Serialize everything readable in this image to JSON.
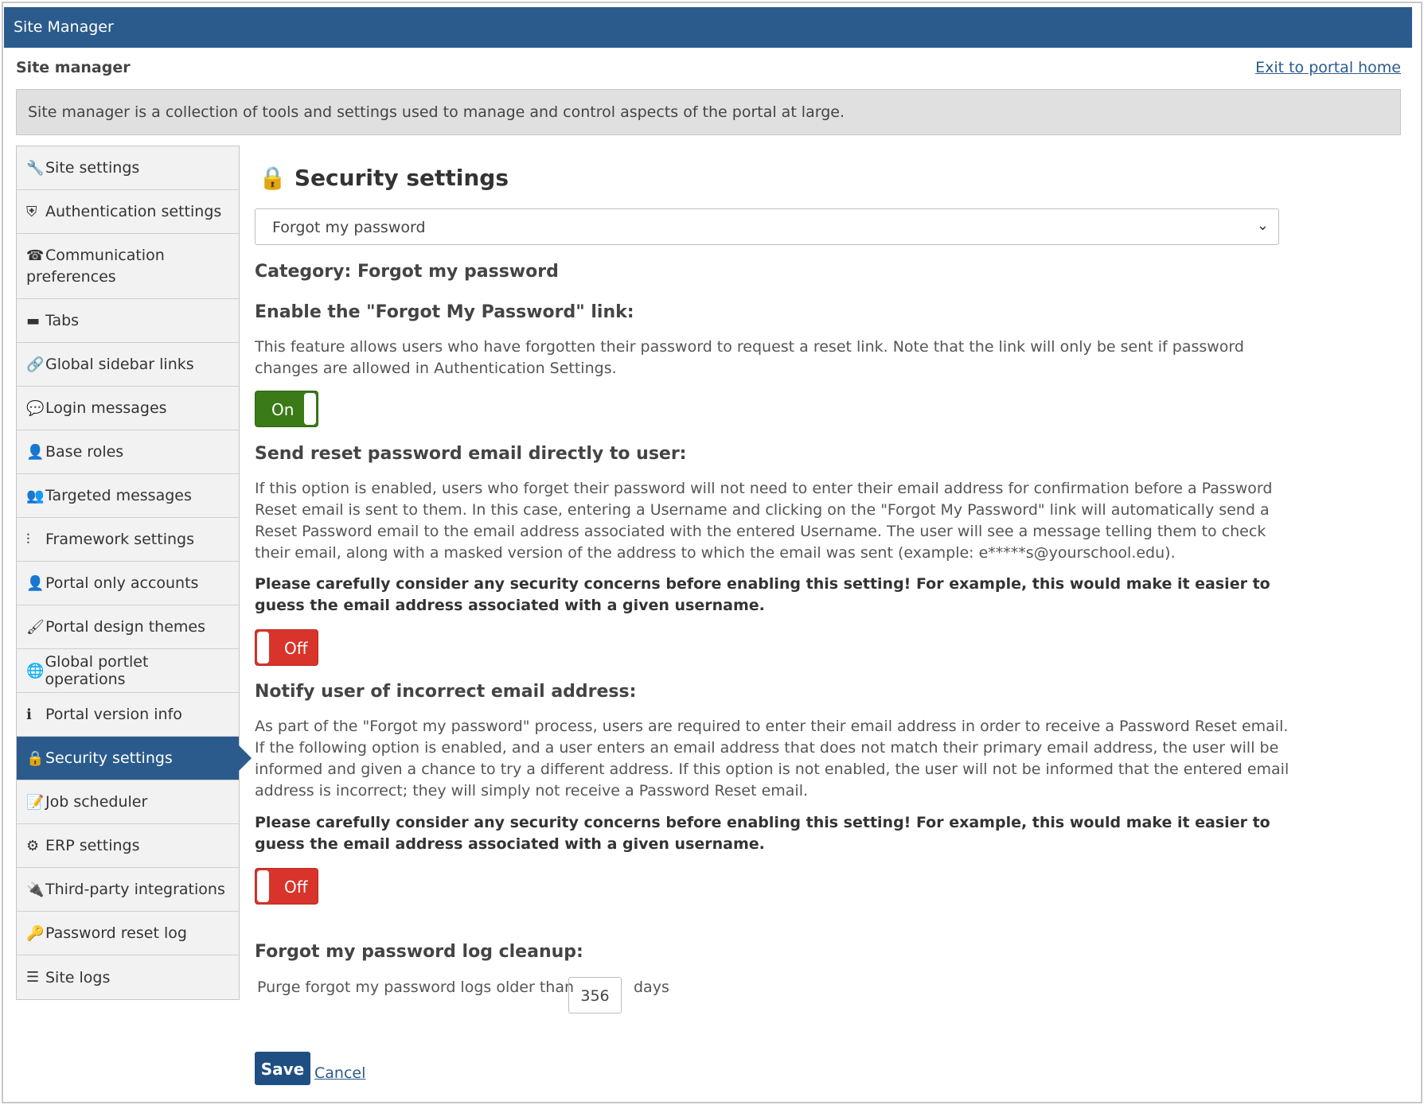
{
  "titlebar": {
    "title": "Site Manager"
  },
  "header": {
    "page_title": "Site manager",
    "exit_link": "Exit to portal home"
  },
  "info": {
    "text": "Site manager is a collection of tools and settings used to manage and control aspects of the portal at large."
  },
  "sidebar": {
    "items": [
      {
        "label": "Site settings",
        "icon": "wrench-icon",
        "glyph": "🔧"
      },
      {
        "label": "Authentication settings",
        "icon": "shield-icon",
        "glyph": "⛨"
      },
      {
        "label": "Communication preferences",
        "icon": "phone-icon",
        "glyph": "☎"
      },
      {
        "label": "Tabs",
        "icon": "folder-icon",
        "glyph": "▬"
      },
      {
        "label": "Global sidebar links",
        "icon": "link-icon",
        "glyph": "🔗"
      },
      {
        "label": "Login messages",
        "icon": "speech-bubble-icon",
        "glyph": "💬"
      },
      {
        "label": "Base roles",
        "icon": "user-role-icon",
        "glyph": "👤"
      },
      {
        "label": "Targeted messages",
        "icon": "users-group-icon",
        "glyph": "👥"
      },
      {
        "label": "Framework settings",
        "icon": "sliders-icon",
        "glyph": "⫶"
      },
      {
        "label": "Portal only accounts",
        "icon": "user-icon",
        "glyph": "👤"
      },
      {
        "label": "Portal design themes",
        "icon": "brush-icon",
        "glyph": "🖌"
      },
      {
        "label": "Global portlet operations",
        "icon": "globe-icon",
        "glyph": "🌐"
      },
      {
        "label": "Portal version info",
        "icon": "info-icon",
        "glyph": "ℹ"
      },
      {
        "label": "Security settings",
        "icon": "lock-icon",
        "glyph": "🔒"
      },
      {
        "label": "Job scheduler",
        "icon": "schedule-icon",
        "glyph": "📝"
      },
      {
        "label": "ERP settings",
        "icon": "gear-icon",
        "glyph": "⚙"
      },
      {
        "label": "Third-party integrations",
        "icon": "plug-icon",
        "glyph": "🔌"
      },
      {
        "label": "Password reset log",
        "icon": "key-log-icon",
        "glyph": "🔑"
      },
      {
        "label": "Site logs",
        "icon": "list-icon",
        "glyph": "☰"
      }
    ]
  },
  "main": {
    "heading": "Security settings",
    "heading_icon": "lock-icon",
    "category_select": {
      "value": "Forgot my password"
    },
    "category_label": "Category: Forgot my password",
    "sections": [
      {
        "title": "Enable the \"Forgot My Password\" link:",
        "description": "This feature allows users who have forgotten their password to request a reset link. Note that the link will only be sent if password changes are allowed in Authentication Settings.",
        "toggle": "On"
      },
      {
        "title": "Send reset password email directly to user:",
        "description": "If this option is enabled, users who forget their password will not need to enter their email address for confirmation before a Password Reset email is sent to them. In this case, entering a Username and clicking on the \"Forgot My Password\" link will automatically send a Reset Password email to the email address associated with the entered Username. The user will see a message telling them to check their email, along with a masked version of the address to which the email was sent (example: e*****s@yourschool.edu).",
        "warning": "Please carefully consider any security concerns before enabling this setting! For example, this would make it easier to guess the email address associated with a given username.",
        "toggle": "Off"
      },
      {
        "title": "Notify user of incorrect email address:",
        "description": "As part of the \"Forgot my password\" process, users are required to enter their email address in order to receive a Password Reset email. If the following option is enabled, and a user enters an email address that does not match their primary email address, the user will be informed and given a chance to try a different address. If this option is not enabled, the user will not be informed that the entered email address is incorrect; they will simply not receive a Password Reset email.",
        "warning": "Please carefully consider any security concerns before enabling this setting! For example, this would make it easier to guess the email address associated with a given username.",
        "toggle": "Off"
      },
      {
        "title": "Forgot my password log cleanup:",
        "purge_prefix": "Purge forgot my password logs older than",
        "purge_days": "356",
        "purge_suffix": "days"
      }
    ],
    "save_label": "Save",
    "cancel_label": "Cancel"
  },
  "colors": {
    "brand": "#2a5b8c",
    "toggle_on": "#3a7a17",
    "toggle_off": "#d8342b"
  }
}
